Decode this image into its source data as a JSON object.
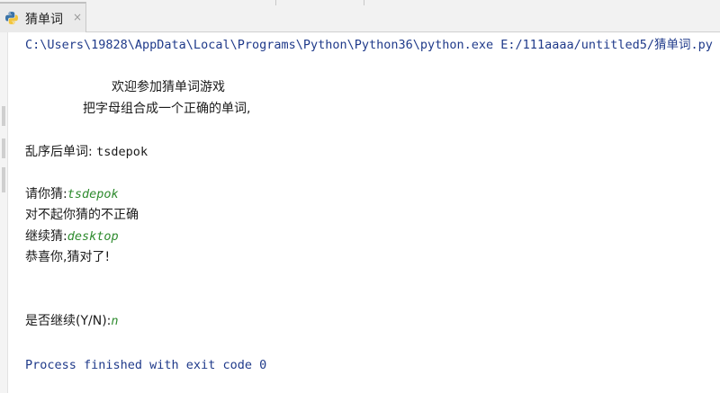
{
  "tab": {
    "title": "猜单词",
    "close_glyph": "×",
    "icon": "python-file-icon"
  },
  "console": {
    "command": "C:\\Users\\19828\\AppData\\Local\\Programs\\Python\\Python36\\python.exe E:/111aaaa/untitled5/猜单词.py",
    "welcome": "欢迎参加猜单词游戏",
    "instruction": "把字母组合成一个正确的单词,",
    "scrambled_label": "乱序后单词: ",
    "scrambled_word": "tsdepok",
    "guess1_prompt": "请你猜:",
    "guess1_input": "tsdepok",
    "wrong_msg": "对不起你猜的不正确",
    "guess2_prompt": "继续猜:",
    "guess2_input": "desktop",
    "correct_msg": "恭喜你,猜对了!",
    "continue_prompt": "是否继续(Y/N):",
    "continue_input": "n",
    "exit_msg": "Process finished with exit code 0"
  },
  "colors": {
    "command_text": "#1f3a8a",
    "user_input": "#2e8b2e",
    "exit_text": "#1f3a8a",
    "normal_text": "#1a1a1a"
  }
}
